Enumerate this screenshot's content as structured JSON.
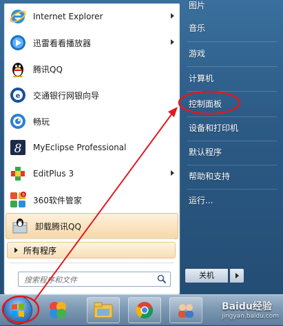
{
  "programs": [
    {
      "label": "Internet Explorer",
      "icon": "internet-explorer-icon",
      "has_submenu": true
    },
    {
      "label": "迅雷看看播放器",
      "icon": "xunlei-player-icon",
      "has_submenu": true
    },
    {
      "label": "腾讯QQ",
      "icon": "qq-penguin-icon",
      "has_submenu": false
    },
    {
      "label": "交通银行网银向导",
      "icon": "bank-wizard-icon",
      "has_submenu": false
    },
    {
      "label": "畅玩",
      "icon": "changwan-icon",
      "has_submenu": false
    },
    {
      "label": "MyEclipse Professional",
      "icon": "myeclipse-icon",
      "has_submenu": false
    },
    {
      "label": "EditPlus 3",
      "icon": "editplus-icon",
      "has_submenu": true
    },
    {
      "label": "360软件管家",
      "icon": "360-manager-icon",
      "has_submenu": false
    },
    {
      "label": "卸载腾讯QQ",
      "icon": "uninstall-qq-icon",
      "has_submenu": false,
      "highlighted": true
    }
  ],
  "all_programs_label": "所有程序",
  "search": {
    "placeholder": "搜索程序和文件"
  },
  "right_items": [
    {
      "label": "图片"
    },
    {
      "label": "音乐"
    },
    {
      "label": "游戏"
    },
    {
      "label": "计算机"
    },
    {
      "label": "控制面板",
      "circled": true
    },
    {
      "label": "设备和打印机"
    },
    {
      "label": "默认程序"
    },
    {
      "label": "帮助和支持"
    },
    {
      "label": "运行..."
    }
  ],
  "shutdown_label": "关机",
  "taskbar": {
    "items": [
      "start-orb",
      "pinwheel-app-icon",
      "file-explorer-icon",
      "chrome-icon",
      "contacts-icon"
    ],
    "watermark": "Baidu经验",
    "watermark_url": "jingyan.baidu.com"
  },
  "colors": {
    "annotation_red": "#e0191f",
    "highlight": "#f6d8a8",
    "menu_blue": "#2c5b86"
  }
}
